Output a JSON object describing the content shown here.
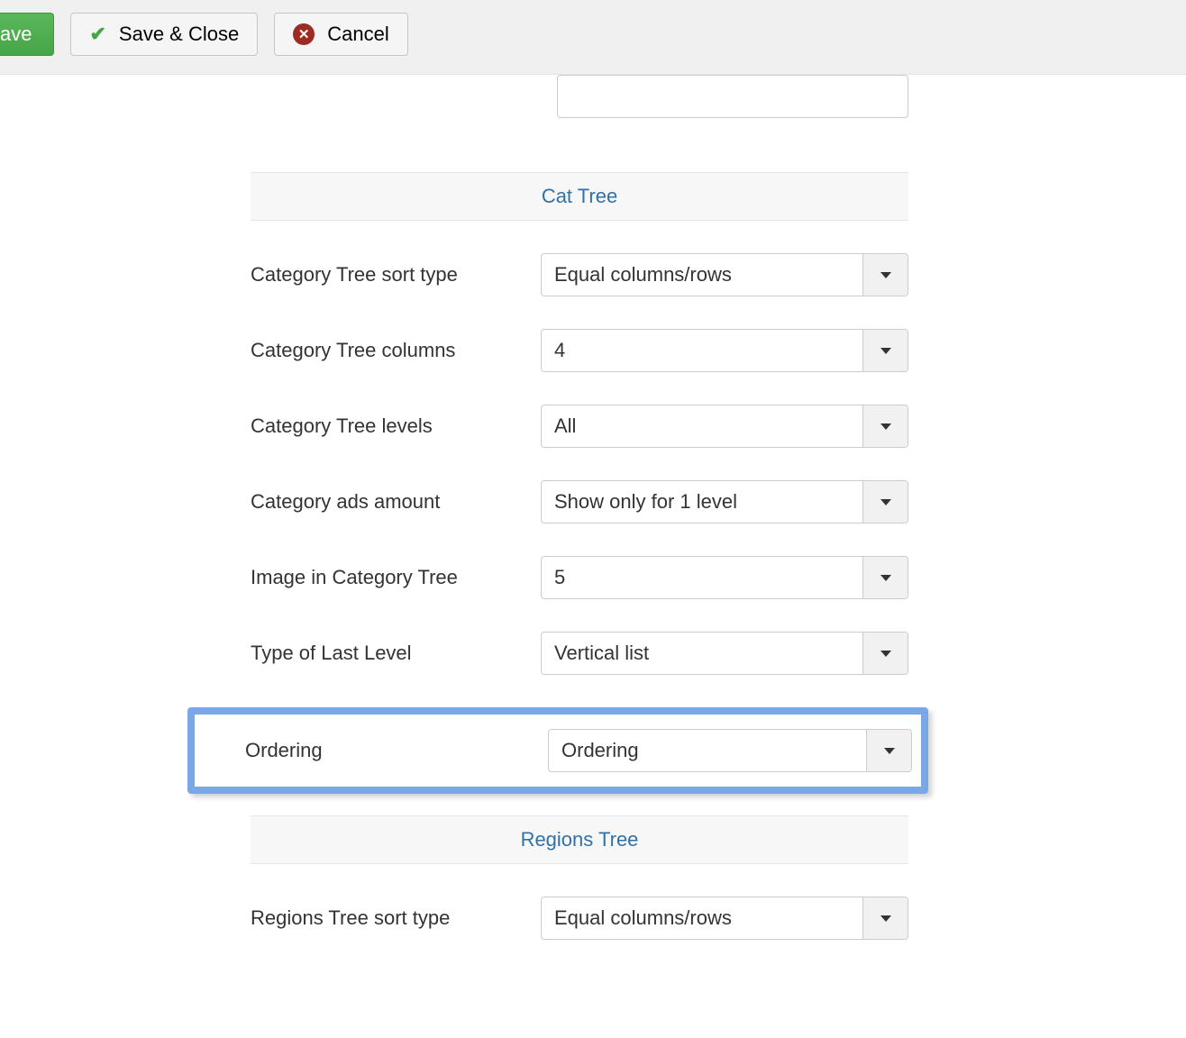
{
  "toolbar": {
    "save_label": "ave",
    "save_close_label": "Save & Close",
    "cancel_label": "Cancel"
  },
  "sections": {
    "cat_tree": {
      "title": "Cat Tree",
      "fields": {
        "sort_type": {
          "label": "Category Tree sort type",
          "value": "Equal columns/rows"
        },
        "columns": {
          "label": "Category Tree columns",
          "value": "4"
        },
        "levels": {
          "label": "Category Tree levels",
          "value": "All"
        },
        "ads_amount": {
          "label": "Category ads amount",
          "value": "Show only for 1 level"
        },
        "image_in": {
          "label": "Image in Category Tree",
          "value": "5"
        },
        "last_level": {
          "label": "Type of Last Level",
          "value": "Vertical list"
        },
        "ordering": {
          "label": "Ordering",
          "value": "Ordering"
        }
      }
    },
    "regions_tree": {
      "title": "Regions Tree",
      "fields": {
        "sort_type": {
          "label": "Regions Tree sort type",
          "value": "Equal columns/rows"
        }
      }
    }
  }
}
